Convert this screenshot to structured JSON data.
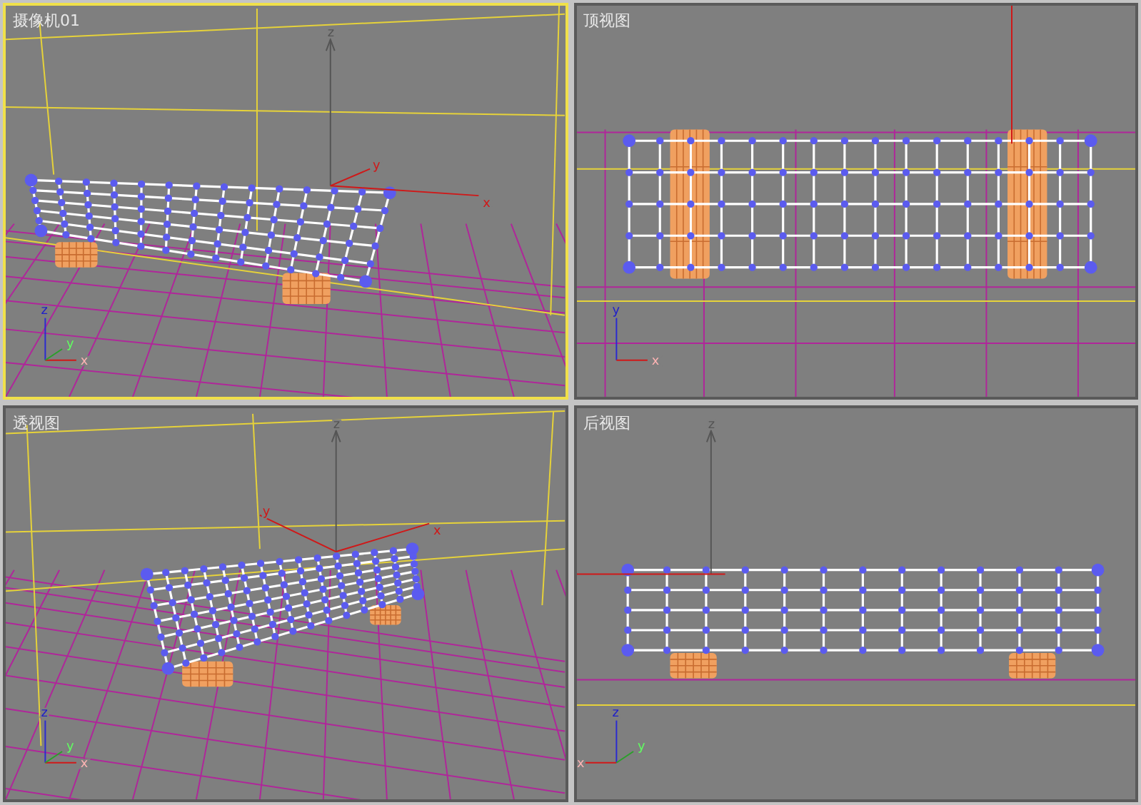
{
  "viewports": [
    {
      "title": "摄像机01",
      "kind": "camera",
      "active": true,
      "gizmo_labels": [
        "z",
        "x",
        "y"
      ],
      "tripod_labels": [
        "z",
        "x",
        "y"
      ]
    },
    {
      "title": "顶视图",
      "kind": "top",
      "active": false,
      "tripod_labels": [
        "y",
        "x"
      ]
    },
    {
      "title": "透视图",
      "kind": "perspective",
      "active": false,
      "gizmo_labels": [
        "z",
        "x",
        "y"
      ],
      "tripod_labels": [
        "z",
        "x",
        "y"
      ]
    },
    {
      "title": "后视图",
      "kind": "back",
      "active": false,
      "gizmo_labels": [
        "z"
      ],
      "tripod_labels": [
        "z",
        "x",
        "y"
      ]
    }
  ]
}
